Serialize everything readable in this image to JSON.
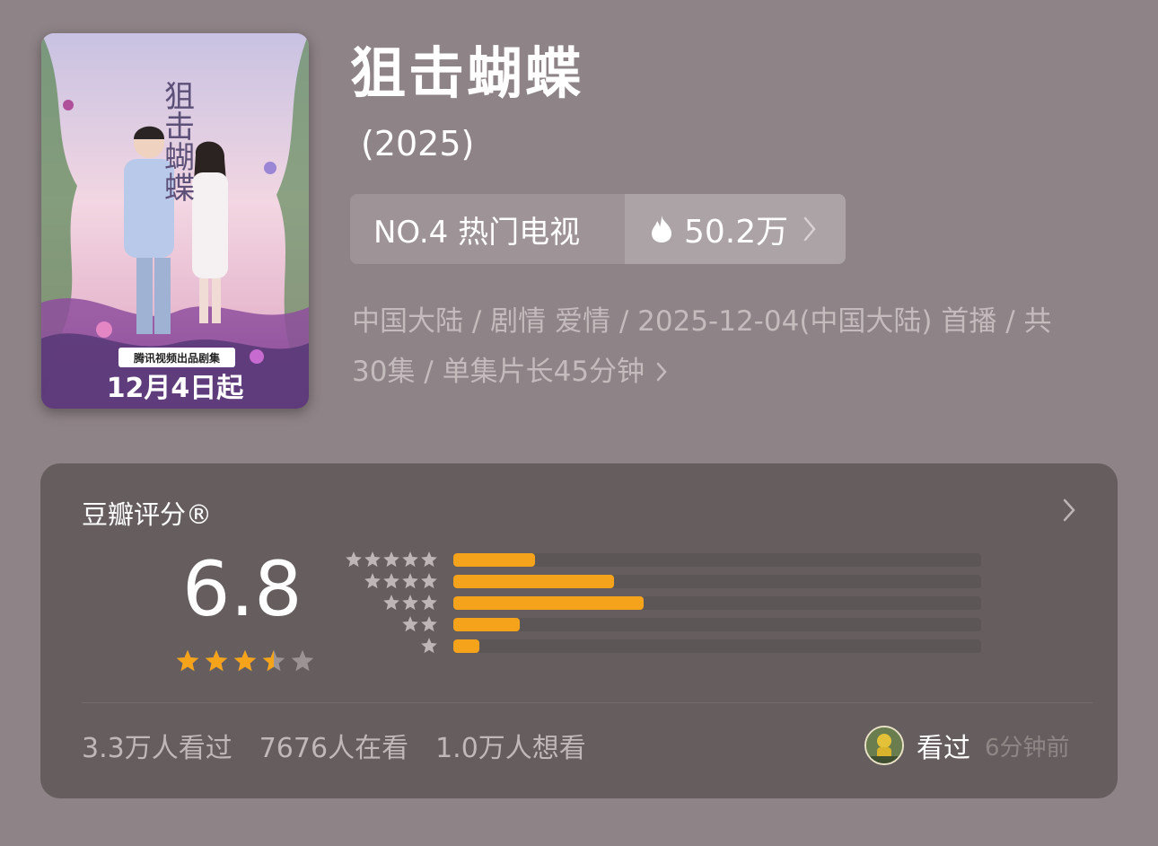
{
  "poster": {
    "title_art": "狙击蝴蝶",
    "badge": "腾讯视频出品剧集",
    "release": "12月4日起"
  },
  "show": {
    "title": "狙击蝴蝶",
    "year": "(2025)"
  },
  "rank": {
    "label": "NO.4 热门电视",
    "heat": "50.2万"
  },
  "meta": {
    "line1": "中国大陆 / 剧情 爱情 / 2025-12-04(中国大陆) 首播 / 共",
    "line2": "30集 / 单集片长45分钟"
  },
  "rating": {
    "header": "豆瓣评分®",
    "score": "6.8",
    "stars_value": 3.5,
    "distribution": [
      {
        "stars": 5,
        "fraction": 0.155
      },
      {
        "stars": 4,
        "fraction": 0.305
      },
      {
        "stars": 3,
        "fraction": 0.36
      },
      {
        "stars": 2,
        "fraction": 0.125
      },
      {
        "stars": 1,
        "fraction": 0.05
      }
    ]
  },
  "stats": {
    "watched": "3.3万人看过",
    "watching": "7676人在看",
    "want": "1.0万人想看"
  },
  "my_status": {
    "label": "看过",
    "time": "6分钟前"
  },
  "colors": {
    "background": "#8e8386",
    "card": "#665e5e",
    "star": "#f5a31a",
    "bar": "#f5a31a"
  }
}
